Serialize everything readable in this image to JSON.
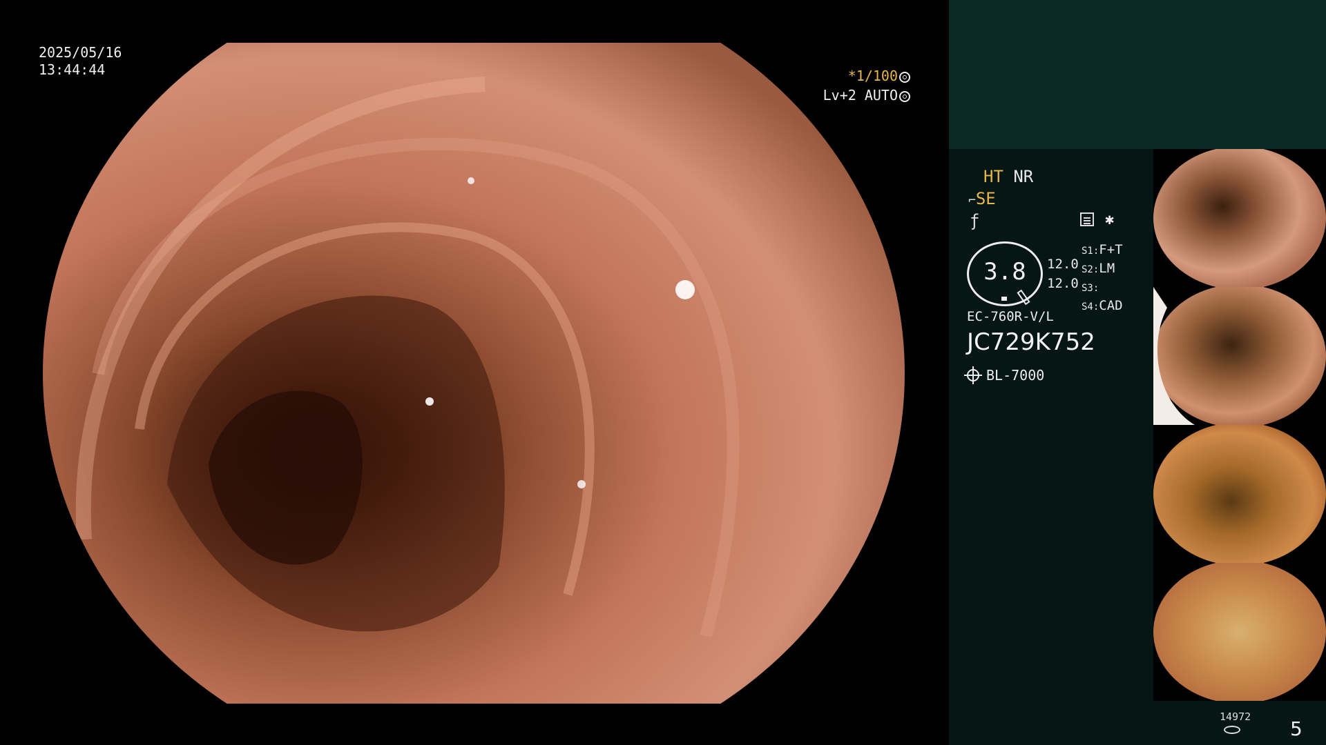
{
  "overlay": {
    "date": "2025/05/16",
    "time": "13:44:44",
    "shutter": "*1/100",
    "level": "Lv+2 AUTO"
  },
  "settings": {
    "ht": "HT",
    "nr": "NR",
    "se": "SE",
    "zoom": "3.8",
    "value_1": "12.0",
    "value_2": "12.0",
    "switches": [
      {
        "key": "S1",
        "value": "F+T"
      },
      {
        "key": "S2",
        "value": "LM"
      },
      {
        "key": "S3",
        "value": ""
      },
      {
        "key": "S4",
        "value": "CAD"
      }
    ],
    "scope_model": "EC-760R-V/L",
    "serial": "JC729K752",
    "light_source": "BL-7000"
  },
  "footer": {
    "image_count": "14972",
    "page": "5"
  },
  "icons": [
    "exposure-dial-icon",
    "auto-iris-icon",
    "scope-se-icon",
    "f-curve-icon",
    "memo-icon",
    "star-icon",
    "light-source-icon",
    "capture-count-icon"
  ]
}
